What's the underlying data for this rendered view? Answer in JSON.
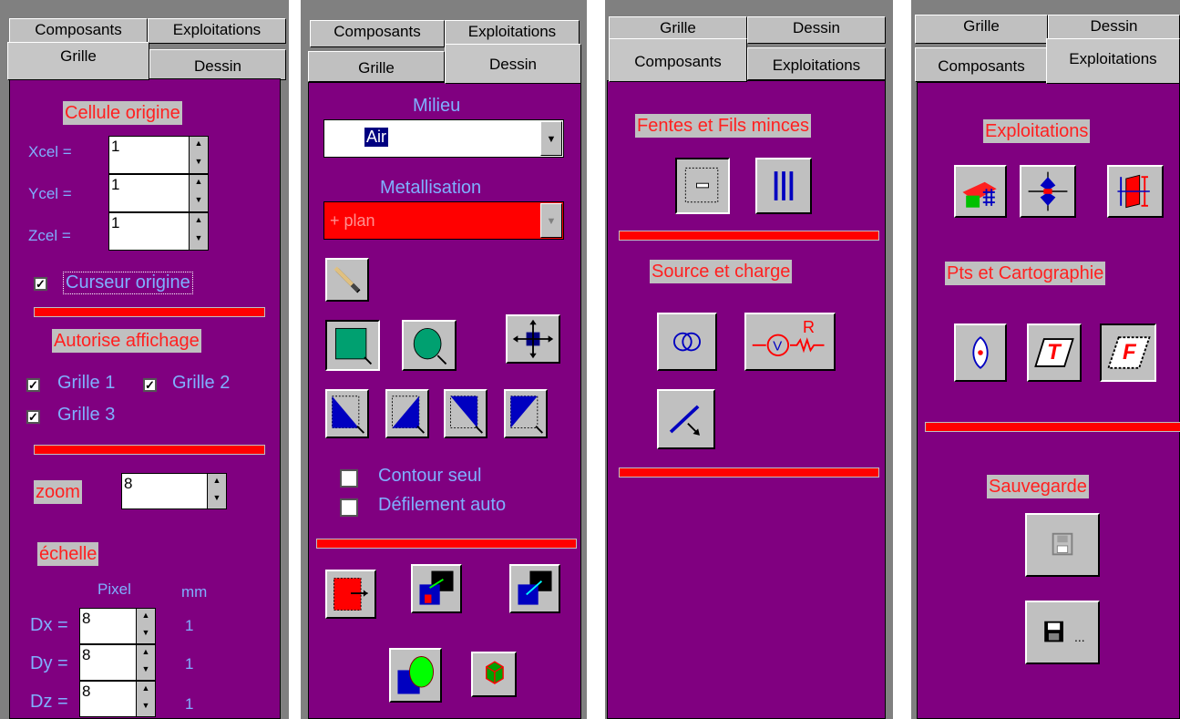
{
  "panel1": {
    "tabs": {
      "composants": "Composants",
      "exploitations": "Exploitations",
      "grille": "Grille",
      "dessin": "Dessin"
    },
    "cellule_origine": "Cellule origine",
    "xcel_label": "Xcel =",
    "xcel_value": "1",
    "ycel_label": "Ycel =",
    "ycel_value": "1",
    "zcel_label": "Zcel =",
    "zcel_value": "1",
    "curseur_origine": "Curseur origine",
    "autorise_affichage": "Autorise affichage",
    "grille1": "Grille 1",
    "grille2": "Grille 2",
    "grille3": "Grille 3",
    "zoom_label": "zoom",
    "zoom_value": "8",
    "echelle": "échelle",
    "pixel_header": "Pixel",
    "mm_header": "mm",
    "dx_label": "Dx =",
    "dx_value": "8",
    "dx_mm": "1",
    "dy_label": "Dy =",
    "dy_value": "8",
    "dy_mm": "1",
    "dz_label": "Dz =",
    "dz_value": "8",
    "dz_mm": "1"
  },
  "panel2": {
    "tabs": {
      "composants": "Composants",
      "exploitations": "Exploitations",
      "grille": "Grille",
      "dessin": "Dessin"
    },
    "milieu": "Milieu",
    "milieu_value": "Air",
    "metallisation": "Metallisation",
    "metallisation_value": "+ plan",
    "contour_seul": "Contour seul",
    "defilement_auto": "Défilement auto"
  },
  "panel3": {
    "tabs": {
      "grille": "Grille",
      "dessin": "Dessin",
      "composants": "Composants",
      "exploitations": "Exploitations"
    },
    "fentes": "Fentes et Fils minces",
    "source": "Source et charge",
    "resistor_letter": "R"
  },
  "panel4": {
    "tabs": {
      "grille": "Grille",
      "dessin": "Dessin",
      "composants": "Composants",
      "exploitations": "Exploitations"
    },
    "exploitations_label": "Exploitations",
    "pts_cartographie": "Pts et Cartographie",
    "t_letter": "T",
    "f_letter": "F",
    "sauvegarde": "Sauvegarde",
    "save_as_suffix": "..."
  },
  "colors": {
    "panel_bg": "#800080",
    "label_red": "#ff2020",
    "text_blue": "#7fb0ff",
    "bar_red": "#ff0000",
    "button_gray": "#c0c0c0"
  }
}
